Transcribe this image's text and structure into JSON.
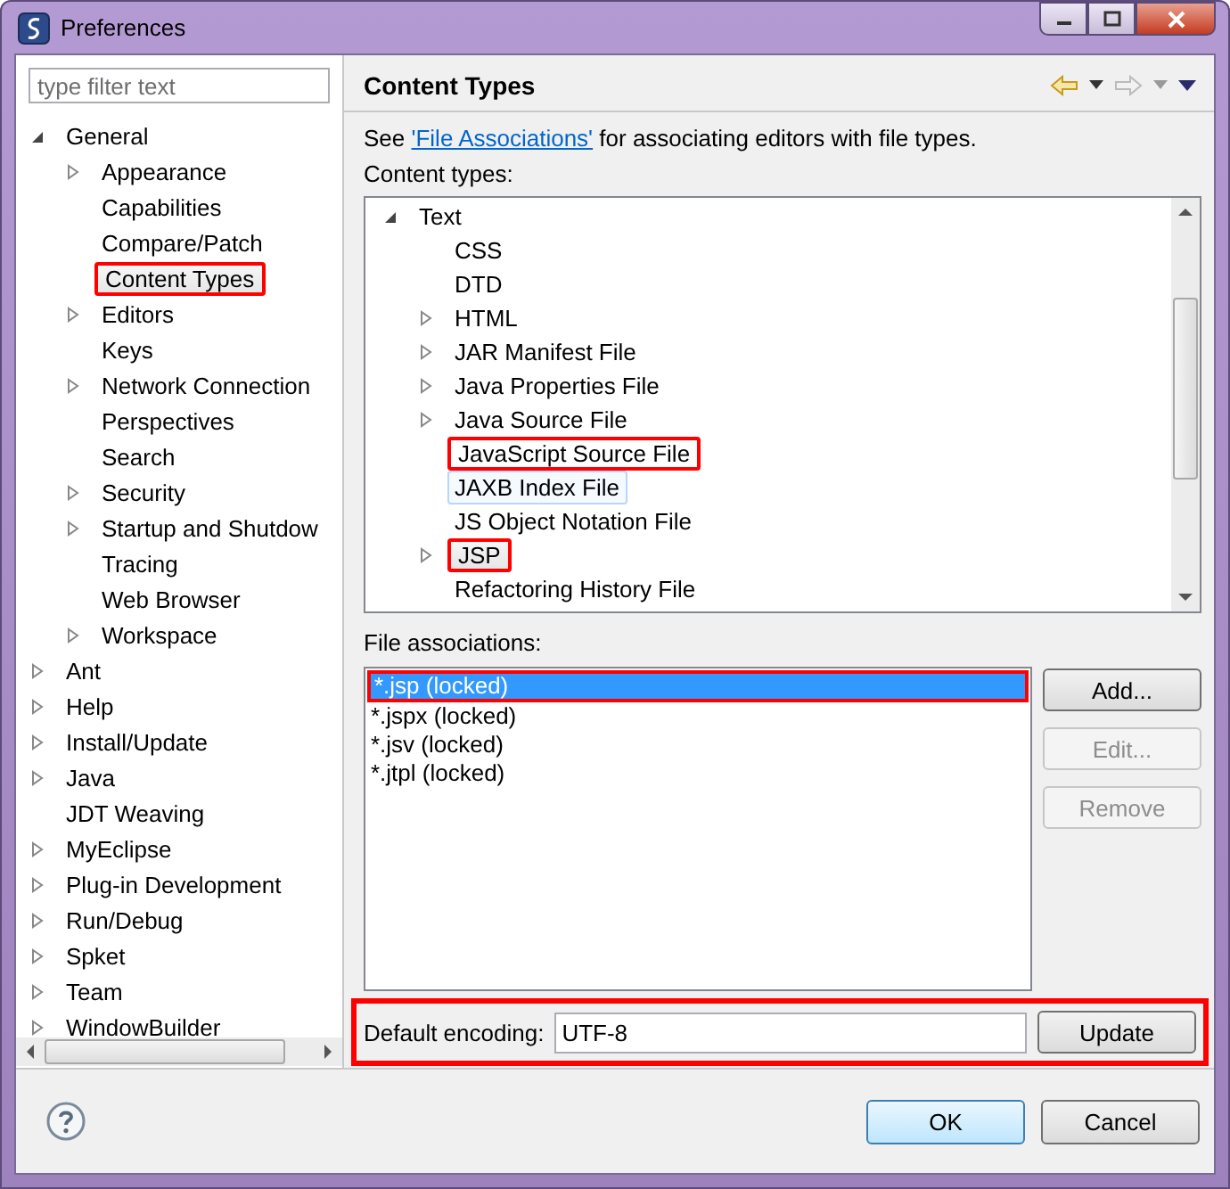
{
  "window": {
    "title": "Preferences"
  },
  "filter": {
    "placeholder": "type filter text"
  },
  "sidebar": {
    "items": [
      {
        "label": "General",
        "expanded": true,
        "selected": false,
        "children": [
          {
            "label": "Appearance",
            "expanded": false,
            "selected": false
          },
          {
            "label": "Capabilities",
            "selected": false
          },
          {
            "label": "Compare/Patch",
            "selected": false
          },
          {
            "label": "Content Types",
            "selected": true,
            "annotated": true
          },
          {
            "label": "Editors",
            "expanded": false,
            "selected": false
          },
          {
            "label": "Keys",
            "selected": false
          },
          {
            "label": "Network Connection",
            "expanded": false,
            "selected": false
          },
          {
            "label": "Perspectives",
            "selected": false
          },
          {
            "label": "Search",
            "selected": false
          },
          {
            "label": "Security",
            "expanded": false,
            "selected": false
          },
          {
            "label": "Startup and Shutdow",
            "expanded": false,
            "selected": false
          },
          {
            "label": "Tracing",
            "selected": false
          },
          {
            "label": "Web Browser",
            "selected": false
          },
          {
            "label": "Workspace",
            "expanded": false,
            "selected": false
          }
        ]
      },
      {
        "label": "Ant",
        "expanded": false,
        "selected": false
      },
      {
        "label": "Help",
        "expanded": false,
        "selected": false
      },
      {
        "label": "Install/Update",
        "expanded": false,
        "selected": false
      },
      {
        "label": "Java",
        "expanded": false,
        "selected": false
      },
      {
        "label": "JDT Weaving",
        "selected": false
      },
      {
        "label": "MyEclipse",
        "expanded": false,
        "selected": false
      },
      {
        "label": "Plug-in Development",
        "expanded": false,
        "selected": false
      },
      {
        "label": "Run/Debug",
        "expanded": false,
        "selected": false
      },
      {
        "label": "Spket",
        "expanded": false,
        "selected": false
      },
      {
        "label": "Team",
        "expanded": false,
        "selected": false
      },
      {
        "label": "WindowBuilder",
        "expanded": false,
        "selected": false
      }
    ]
  },
  "page": {
    "title": "Content Types",
    "description": {
      "before": "See ",
      "link": "'File Associations'",
      "after": " for associating editors with file types."
    },
    "content_types_label": "Content types:",
    "content_types": [
      {
        "label": "Text",
        "expanded": true,
        "selected": false,
        "children": [
          {
            "label": "CSS",
            "selected": false
          },
          {
            "label": "DTD",
            "selected": false
          },
          {
            "label": "HTML",
            "expanded": false,
            "selected": false
          },
          {
            "label": "JAR Manifest File",
            "expanded": false,
            "selected": false
          },
          {
            "label": "Java Properties File",
            "expanded": false,
            "selected": false
          },
          {
            "label": "Java Source File",
            "expanded": false,
            "selected": false
          },
          {
            "label": "JavaScript Source File",
            "selected": false,
            "annotated": true
          },
          {
            "label": "JAXB Index File",
            "selected": false,
            "hovered": true
          },
          {
            "label": "JS Object Notation File",
            "selected": false
          },
          {
            "label": "JSP",
            "expanded": false,
            "selected": true,
            "annotated": true
          },
          {
            "label": "Refactoring History File",
            "selected": false
          }
        ]
      }
    ],
    "file_associations_label": "File associations:",
    "file_associations": [
      {
        "label": "*.jsp (locked)",
        "selected": true,
        "annotated": true
      },
      {
        "label": "*.jspx (locked)",
        "selected": false
      },
      {
        "label": "*.jsv (locked)",
        "selected": false
      },
      {
        "label": "*.jtpl (locked)",
        "selected": false
      }
    ],
    "side_buttons": [
      {
        "label": "Add...",
        "disabled": false
      },
      {
        "label": "Edit...",
        "disabled": true
      },
      {
        "label": "Remove",
        "disabled": true
      }
    ],
    "encoding": {
      "label": "Default encoding:",
      "value": "UTF-8",
      "button": "Update",
      "annotated": true
    }
  },
  "buttons": [
    "OK",
    "Cancel"
  ]
}
